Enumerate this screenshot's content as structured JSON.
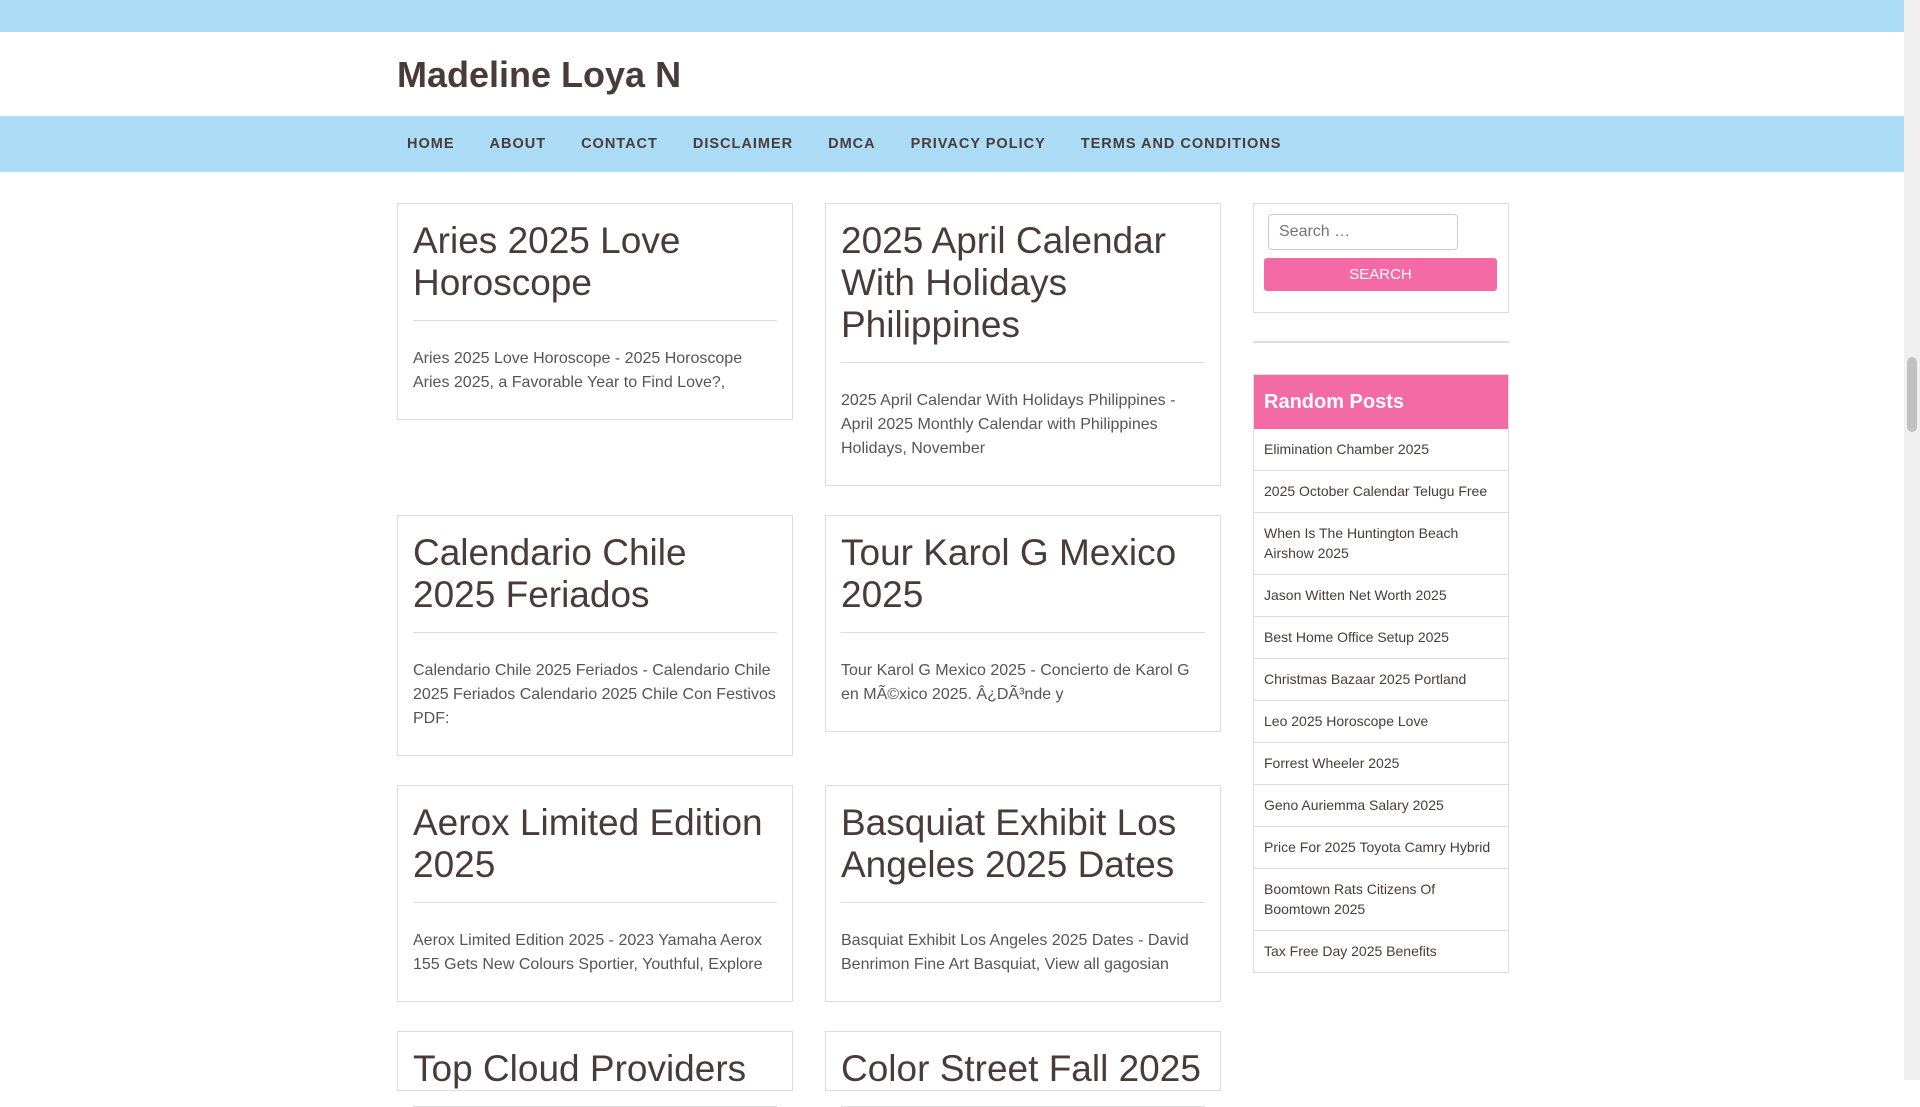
{
  "site": {
    "title": "Madeline Loya N"
  },
  "nav": {
    "items": [
      "HOME",
      "ABOUT",
      "CONTACT",
      "DISCLAIMER",
      "DMCA",
      "PRIVACY POLICY",
      "TERMS AND CONDITIONS"
    ]
  },
  "posts": [
    {
      "title": "Aries 2025 Love Horoscope",
      "excerpt": "Aries 2025 Love Horoscope - 2025 Horoscope Aries 2025, a Favorable Year to Find Love?,"
    },
    {
      "title": "2025 April Calendar With Holidays Philippines",
      "excerpt": "2025 April Calendar With Holidays Philippines - April 2025 Monthly Calendar with Philippines Holidays, November"
    },
    {
      "title": "Calendario Chile 2025 Feriados",
      "excerpt": "Calendario Chile 2025 Feriados - Calendario Chile 2025 Feriados Calendario 2025 Chile Con Festivos PDF:"
    },
    {
      "title": "Tour Karol G Mexico 2025",
      "excerpt": "Tour Karol G Mexico 2025 - Concierto de Karol G en MÃ©xico 2025. Â¿DÃ³nde y"
    },
    {
      "title": "Aerox Limited Edition 2025",
      "excerpt": "Aerox Limited Edition 2025 - 2023 Yamaha Aerox 155 Gets New Colours Sportier, Youthful, Explore"
    },
    {
      "title": "Basquiat Exhibit Los Angeles 2025 Dates",
      "excerpt": "Basquiat Exhibit Los Angeles 2025 Dates - David Benrimon Fine Art Basquiat, View all gagosian"
    },
    {
      "title": "Top Cloud Providers",
      "excerpt": ""
    },
    {
      "title": "Color Street Fall 2025",
      "excerpt": ""
    }
  ],
  "search": {
    "placeholder": "Search …",
    "button": "SEARCH"
  },
  "random_posts": {
    "heading": "Random Posts",
    "items": [
      "Elimination Chamber 2025",
      "2025 October Calendar Telugu Free",
      "When Is The Huntington Beach Airshow 2025",
      "Jason Witten Net Worth 2025",
      "Best Home Office Setup 2025",
      "Christmas Bazaar 2025 Portland",
      "Leo 2025 Horoscope Love",
      "Forrest Wheeler 2025",
      "Geno Auriemma Salary 2025",
      "Price For 2025 Toyota Camry Hybrid",
      "Boomtown Rats Citizens Of Boomtown 2025",
      "Tax Free Day 2025 Benefits"
    ]
  },
  "colors": {
    "accent": "#f46aa5",
    "nav_bg": "#acdbf5",
    "text": "#4a3b3b"
  }
}
